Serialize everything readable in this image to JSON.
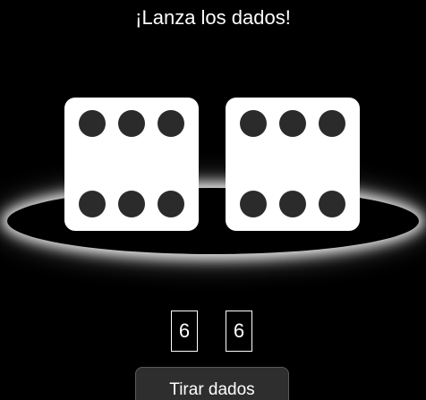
{
  "title": "¡Lanza los dados!",
  "dice": [
    {
      "value": 6
    },
    {
      "value": 6
    }
  ],
  "results": {
    "die1": "6",
    "die2": "6"
  },
  "roll_button_label": "Tirar dados",
  "colors": {
    "background": "#000000",
    "die_face": "#ffffff",
    "pip": "#2b2b2b",
    "glow": "#ffffff",
    "button_bg": "#2e2e2e"
  }
}
